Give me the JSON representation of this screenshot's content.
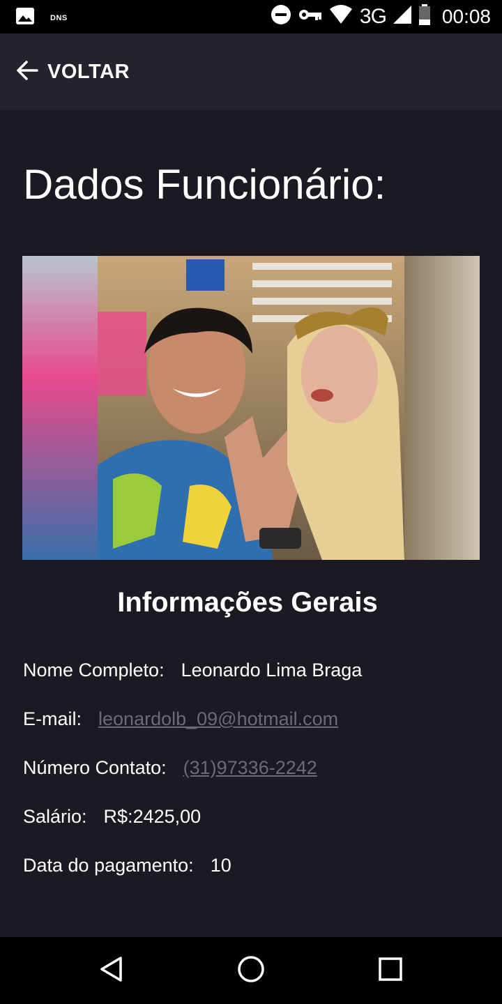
{
  "status_bar": {
    "left_icons": [
      "image-icon",
      "dns-label"
    ],
    "dns_label": "DNS",
    "right_icons": [
      "dnd-icon",
      "vpn-key-icon",
      "wifi-icon",
      "signal-icon",
      "battery-icon"
    ],
    "network": "3G",
    "time": "00:08"
  },
  "app_bar": {
    "back_icon": "arrow-left-icon",
    "back_label": "VOLTAR"
  },
  "page": {
    "title": "Dados Funcionário:",
    "photo_alt": "employee photo",
    "section_title": "Informações Gerais"
  },
  "info": {
    "name_label": "Nome Completo:",
    "name_value": "Leonardo Lima Braga",
    "email_label": "E-mail:",
    "email_value": "leonardolb_09@hotmail.com",
    "phone_label": "Número Contato:",
    "phone_value": "(31)97336-2242",
    "salary_label": "Salário:",
    "salary_value": "R$:2425,00",
    "payday_label": "Data do pagamento:",
    "payday_value": "10"
  },
  "nav_bar": {
    "icons": [
      "back-triangle-icon",
      "home-circle-icon",
      "recents-square-icon"
    ]
  },
  "colors": {
    "background": "#1b1a23",
    "app_bar": "#24232e",
    "link": "#6b6b74",
    "text": "#ffffff"
  }
}
